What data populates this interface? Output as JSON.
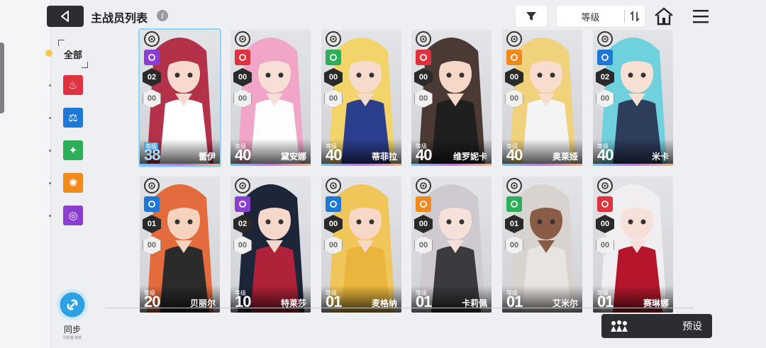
{
  "header": {
    "title": "主战员列表",
    "info_glyph": "i",
    "sort_label": "等级"
  },
  "filters": {
    "all_label": "全部",
    "elements": [
      {
        "name": "fire",
        "color": "#e0313f",
        "glyph": "♨"
      },
      {
        "name": "water",
        "color": "#1f78d6",
        "glyph": "⚖"
      },
      {
        "name": "wind",
        "color": "#2fae59",
        "glyph": "✦"
      },
      {
        "name": "electric",
        "color": "#f08a1c",
        "glyph": "✺"
      },
      {
        "name": "iron",
        "color": "#8b3fd1",
        "glyph": "◎"
      }
    ]
  },
  "sync": {
    "label": "同步",
    "sub": "同步器 装载"
  },
  "cards": [
    {
      "name": "蕾伊",
      "level_word": "等级",
      "level": "38",
      "burst": "02",
      "skill": "00",
      "elem_color": "#8b3fd1",
      "hair": "#b3324a",
      "skin": "#f7d9cf",
      "outfit": "#ffffff",
      "selected": true
    },
    {
      "name": "黛安娜",
      "level_word": "等级",
      "level": "40",
      "burst": "00",
      "skill": "00",
      "elem_color": "#e0313f",
      "hair": "#f1a5c8",
      "skin": "#f8dfd6",
      "outfit": "#fdfdfd",
      "selected": false
    },
    {
      "name": "蒂菲拉",
      "level_word": "等级",
      "level": "40",
      "burst": "00",
      "skill": "00",
      "elem_color": "#2fae59",
      "hair": "#f2d46a",
      "skin": "#f7dbcd",
      "outfit": "#2c3f8f",
      "selected": false
    },
    {
      "name": "维罗妮卡",
      "level_word": "等级",
      "level": "40",
      "burst": "00",
      "skill": "00",
      "elem_color": "#e0313f",
      "hair": "#4a3a33",
      "skin": "#f5d8c8",
      "outfit": "#1f1f1f",
      "selected": false
    },
    {
      "name": "奥莱娅",
      "level_word": "等级",
      "level": "40",
      "burst": "00",
      "skill": "00",
      "elem_color": "#f08a1c",
      "hair": "#f0d27c",
      "skin": "#f8dccd",
      "outfit": "#f4f4f4",
      "selected": false
    },
    {
      "name": "米卡",
      "level_word": "等级",
      "level": "40",
      "burst": "02",
      "skill": "00",
      "elem_color": "#1f78d6",
      "hair": "#6fd0de",
      "skin": "#f8e0d4",
      "outfit": "#2e3d5c",
      "selected": false
    },
    {
      "name": "贝丽尔",
      "level_word": "等级",
      "level": "20",
      "burst": "01",
      "skill": "00",
      "elem_color": "#1f78d6",
      "hair": "#e46b3c",
      "skin": "#f6d3bf",
      "outfit": "#2b2b2b",
      "selected": false
    },
    {
      "name": "特莱莎",
      "level_word": "等级",
      "level": "10",
      "burst": "02",
      "skill": "00",
      "elem_color": "#8b3fd1",
      "hair": "#1d2638",
      "skin": "#f6d8cb",
      "outfit": "#b0213a",
      "selected": false
    },
    {
      "name": "麦格纳",
      "level_word": "等级",
      "level": "01",
      "burst": "00",
      "skill": "00",
      "elem_color": "#1f78d6",
      "hair": "#f0c65a",
      "skin": "#f7d7c6",
      "outfit": "#e9b53c",
      "selected": false
    },
    {
      "name": "卡莉佩",
      "level_word": "等级",
      "level": "01",
      "burst": "00",
      "skill": "00",
      "elem_color": "#f08a1c",
      "hair": "#cfc9d2",
      "skin": "#f5e0da",
      "outfit": "#3b3b3f",
      "selected": false
    },
    {
      "name": "艾米尔",
      "level_word": "等级",
      "level": "01",
      "burst": "01",
      "skill": "00",
      "elem_color": "#2fae59",
      "hair": "#d8d3cf",
      "skin": "#8a5c46",
      "outfit": "#e8e4df",
      "selected": false
    },
    {
      "name": "赛琳娜",
      "level_word": "等级",
      "level": "01",
      "burst": "00",
      "skill": "00",
      "elem_color": "#e0313f",
      "hair": "#f0eef0",
      "skin": "#f7e0d8",
      "outfit": "#b5162c",
      "selected": false
    }
  ],
  "preset": {
    "label": "预设"
  }
}
